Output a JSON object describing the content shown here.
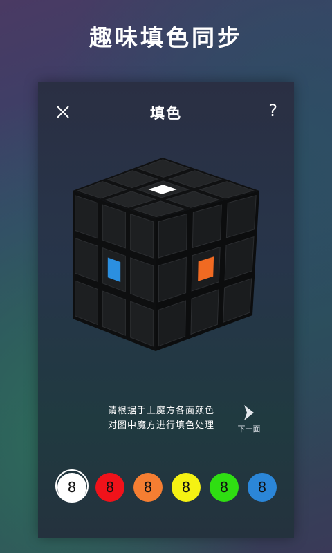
{
  "banner": {
    "text": "趣味填色同步"
  },
  "header": {
    "title": "填色",
    "help_label": "?",
    "close_icon": "close-icon"
  },
  "cube": {
    "top_center_color": "#ffffff",
    "left_center_color": "#2b8fe0",
    "right_center_color": "#f06a22",
    "tile_color": "#1f2022"
  },
  "instructions": {
    "line1": "请根据手上魔方各面颜色",
    "line2": "对图中魔方进行填色处理"
  },
  "next": {
    "label": "下一面",
    "icon": "play-arrow-icon"
  },
  "palette": [
    {
      "name": "white",
      "color": "#ffffff",
      "label": "8",
      "selected": true
    },
    {
      "name": "red",
      "color": "#f0121a",
      "label": "8",
      "selected": false
    },
    {
      "name": "orange",
      "color": "#f57e32",
      "label": "8",
      "selected": false
    },
    {
      "name": "yellow",
      "color": "#f5f213",
      "label": "8",
      "selected": false
    },
    {
      "name": "green",
      "color": "#2fde12",
      "label": "8",
      "selected": false
    },
    {
      "name": "blue",
      "color": "#2b86d8",
      "label": "8",
      "selected": false
    }
  ]
}
